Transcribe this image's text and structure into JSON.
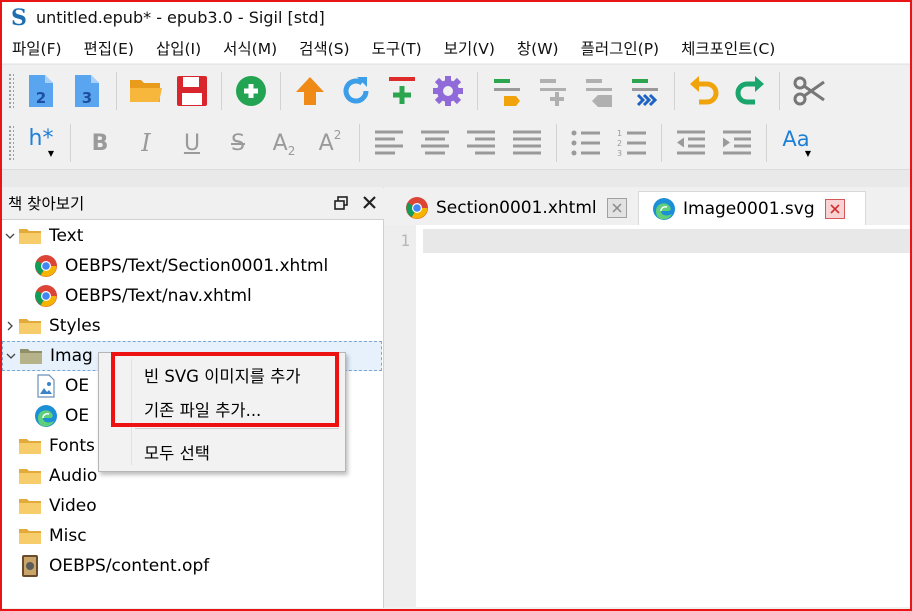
{
  "window": {
    "title": "untitled.epub* - epub3.0 - Sigil [std]",
    "app_icon": "sigil-logo-icon",
    "app_icon_glyph": "S"
  },
  "menu": [
    {
      "id": "file",
      "label": "파일(F)"
    },
    {
      "id": "edit",
      "label": "편집(E)"
    },
    {
      "id": "insert",
      "label": "삽입(I)"
    },
    {
      "id": "format",
      "label": "서식(M)"
    },
    {
      "id": "search",
      "label": "검색(S)"
    },
    {
      "id": "tools",
      "label": "도구(T)"
    },
    {
      "id": "view",
      "label": "보기(V)"
    },
    {
      "id": "window",
      "label": "창(W)"
    },
    {
      "id": "plugins",
      "label": "플러그인(P)"
    },
    {
      "id": "checkpoints",
      "label": "체크포인트(C)"
    }
  ],
  "toolbar": {
    "heading_label": "h*",
    "bold": "B",
    "italic": "I",
    "underline": "U",
    "strike": "S",
    "subscript": "A",
    "subscript_mark": "2",
    "superscript": "A",
    "superscript_mark": "2",
    "case_label": "Aa",
    "colors": {
      "blue": "#2f8de4",
      "orange": "#f0a30a",
      "red": "#e02b2b",
      "green": "#1fa050",
      "purple": "#8f6ad8",
      "gray": "#9a9a9a"
    }
  },
  "book_browser": {
    "title": "책 찾아보기",
    "items": [
      {
        "label": "Text",
        "icon": "folder-icon",
        "expander": "expanded"
      },
      {
        "label": "OEBPS/Text/Section0001.xhtml",
        "icon": "chrome-icon"
      },
      {
        "label": "OEBPS/Text/nav.xhtml",
        "icon": "chrome-icon"
      },
      {
        "label": "Styles",
        "icon": "folder-icon",
        "expander": "collapsed"
      },
      {
        "label": "Images",
        "icon": "folder-icon",
        "expander": "expanded",
        "selected": true
      },
      {
        "label": "OEBPS/Images/cover.png",
        "icon": "image-file-icon"
      },
      {
        "label": "OEBPS/Images/Image0001.svg",
        "icon": "edge-icon"
      },
      {
        "label": "Fonts",
        "icon": "folder-icon"
      },
      {
        "label": "Audio",
        "icon": "folder-icon"
      },
      {
        "label": "Video",
        "icon": "folder-icon"
      },
      {
        "label": "Misc",
        "icon": "folder-icon"
      },
      {
        "label": "OEBPS/content.opf",
        "icon": "opf-file-icon"
      }
    ],
    "visible_labels": {
      "images_partial": "Imag",
      "cover_partial": "OE",
      "svg_partial": "OE"
    }
  },
  "tabs": [
    {
      "label": "Section0001.xhtml",
      "icon": "chrome-icon",
      "active": false
    },
    {
      "label": "Image0001.svg",
      "icon": "edge-icon",
      "active": true
    }
  ],
  "editor": {
    "line_numbers": [
      "1"
    ]
  },
  "context_menu": {
    "items": [
      {
        "label": "빈 SVG 이미지를 추가"
      },
      {
        "label": "기존 파일 추가..."
      },
      {
        "label": "모두 선택"
      }
    ]
  }
}
